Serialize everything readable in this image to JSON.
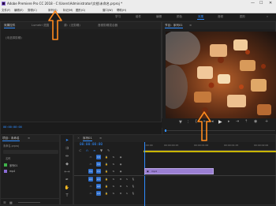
{
  "titlebar": {
    "title": "Adobe Premiere Pro CC 2018 - C:\\Users\\Administrator\\",
    "title_suffix": "文档\\未命名.prproj *",
    "minimize": "—",
    "maximize": "☐",
    "close": "✕"
  },
  "menubar": {
    "items": [
      "文件(F)",
      "编辑(E)",
      "剪辑(C)",
      "序列(S)",
      "标记(M)",
      "图形(G)",
      "窗口(W)",
      "帮助(H)"
    ]
  },
  "workspaces": {
    "items": [
      "学习",
      "组件",
      "编辑",
      "颜色",
      "效果",
      "音频",
      "图形"
    ],
    "active_index": 4,
    "overflow": "»"
  },
  "source_panel": {
    "tabs": [
      "效果控件",
      "Lumetri 范围",
      "源：(无剪辑)",
      "音频剪辑混合器"
    ],
    "empty_text": "(未选择剪辑)"
  },
  "program_monitor": {
    "tab": "节目：序列01",
    "menu": "≡",
    "timecode": "00:00:00:00",
    "zoom": "25%",
    "quality": "完整",
    "end_timecode": "00:00:05:09"
  },
  "project_panel": {
    "tab": "项目：未命名",
    "menu": "≡",
    "file": "未命名.prproj",
    "column_header": "名称",
    "items": [
      {
        "name": "序列01",
        "color": "#3fb24a"
      },
      {
        "name": "mp4",
        "color": "#8b6bd6"
      }
    ]
  },
  "timeline": {
    "tab": "序列01",
    "menu": "≡",
    "timecode": "00:00:00:00",
    "ruler_labels": [
      ":00:00",
      "00:00:00:15",
      "00:00:01:00",
      "00:00:01:15",
      "00:00:02:00"
    ],
    "video_tracks": [
      "V3",
      "V2",
      "V1"
    ],
    "audio_tracks": [
      "A1",
      "A2",
      "A3"
    ],
    "clip_label": "mp4",
    "clip_color": "#9a7fd2"
  },
  "colors": {
    "accent": "#2f8cff",
    "arrow": "#ff8a1e"
  }
}
